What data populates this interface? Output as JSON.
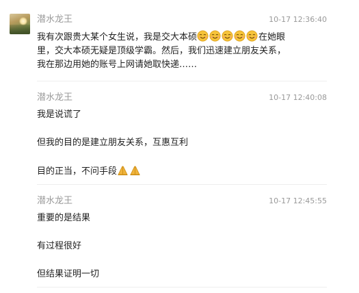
{
  "messages": [
    {
      "nickname": "潜水龙王",
      "time": "10-17 12:36:40",
      "line1_text": "我有次跟贵大某个女生说，我是交大本硕",
      "line1_emoji_count": 5,
      "line1_emoji_icon": "hehe-emoji-icon",
      "line1_tail": "在她眼",
      "line2": "里，交大本硕无疑是顶级学霸。然后，我们迅速建立朋友关系，",
      "line3": "我在那边用她的账号上网请她取快递……"
    },
    {
      "nickname": "潜水龙王",
      "time": "10-17 12:40:08",
      "line1": "我是说谎了",
      "line2": "但我的目的是建立朋友关系，互惠互利",
      "line3_text": "目的正当，不问手段",
      "line3_emoji_count": 2,
      "line3_emoji_icon": "praying-hands-icon"
    },
    {
      "nickname": "潜水龙王",
      "time": "10-17 12:45:55",
      "line1": "重要的是结果",
      "line2": "有过程很好",
      "line3": "但结果证明一切"
    }
  ]
}
